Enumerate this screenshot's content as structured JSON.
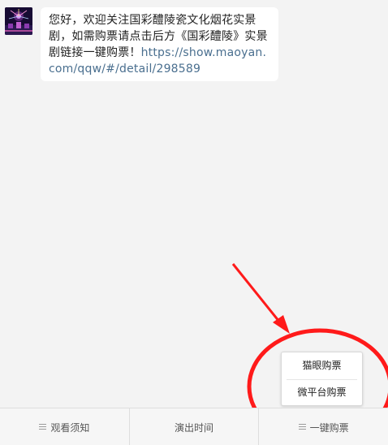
{
  "message": {
    "text_main": "您好，欢迎关注国彩醴陵瓷文化烟花实景剧，如需购票请点击后方《国彩醴陵》实景剧链接一键购票！",
    "link": "https://show.maoyan.com/qqw/#/detail/298589"
  },
  "popup": {
    "items": [
      {
        "label": "猫眼购票"
      },
      {
        "label": "微平台购票"
      }
    ]
  },
  "menu": {
    "items": [
      {
        "label": "观看须知",
        "icon": "menu-icon"
      },
      {
        "label": "演出时间"
      },
      {
        "label": "一键购票",
        "icon": "menu-icon"
      }
    ]
  },
  "colors": {
    "background": "#f3f3f3",
    "annotation": "#ff1a1a",
    "link": "#4a6f8f"
  }
}
